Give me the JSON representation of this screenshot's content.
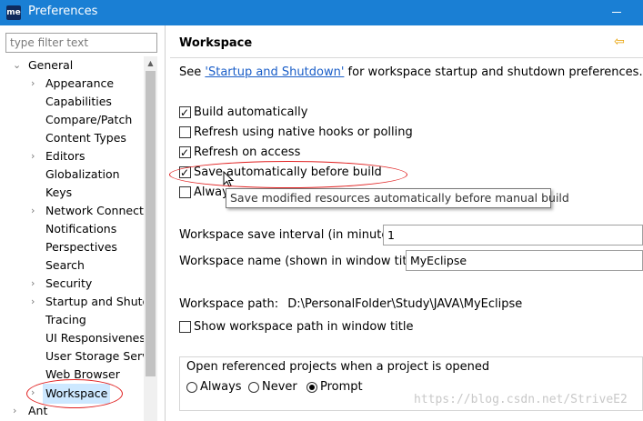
{
  "window": {
    "title": "Preferences",
    "app_icon_text": "me"
  },
  "filter": {
    "placeholder": "type filter text"
  },
  "tree": {
    "general": "General",
    "items": [
      "Appearance",
      "Capabilities",
      "Compare/Patch",
      "Content Types",
      "Editors",
      "Globalization",
      "Keys",
      "Network Connectio",
      "Notifications",
      "Perspectives",
      "Search",
      "Security",
      "Startup and Shutdo",
      "Tracing",
      "UI Responsiveness",
      "User Storage Serv",
      "Web Browser",
      "Workspace"
    ],
    "ant": "Ant"
  },
  "page": {
    "title": "Workspace",
    "see_prefix": "See ",
    "see_link": "'Startup and Shutdown'",
    "see_suffix": " for workspace startup and shutdown preferences."
  },
  "options": {
    "build_auto": "Build automatically",
    "refresh_native": "Refresh using native hooks or polling",
    "refresh_access": "Refresh on access",
    "save_before_build": "Save automatically before build",
    "always_partial": "Alway"
  },
  "tooltip": "Save modified resources automatically before manual build",
  "fields": {
    "save_interval_label": "Workspace save interval (in minutes):",
    "save_interval_value": "1",
    "name_label": "Workspace name (shown in window title):",
    "name_value": "MyEclipse",
    "path_label": "Workspace path:",
    "path_value": "D:\\PersonalFolder\\Study\\JAVA\\MyEclipse",
    "show_path": "Show workspace path in window title"
  },
  "open_projects": {
    "title": "Open referenced projects when a project is opened",
    "always": "Always",
    "never": "Never",
    "prompt": "Prompt"
  },
  "watermark": "https://blog.csdn.net/StriveE2"
}
